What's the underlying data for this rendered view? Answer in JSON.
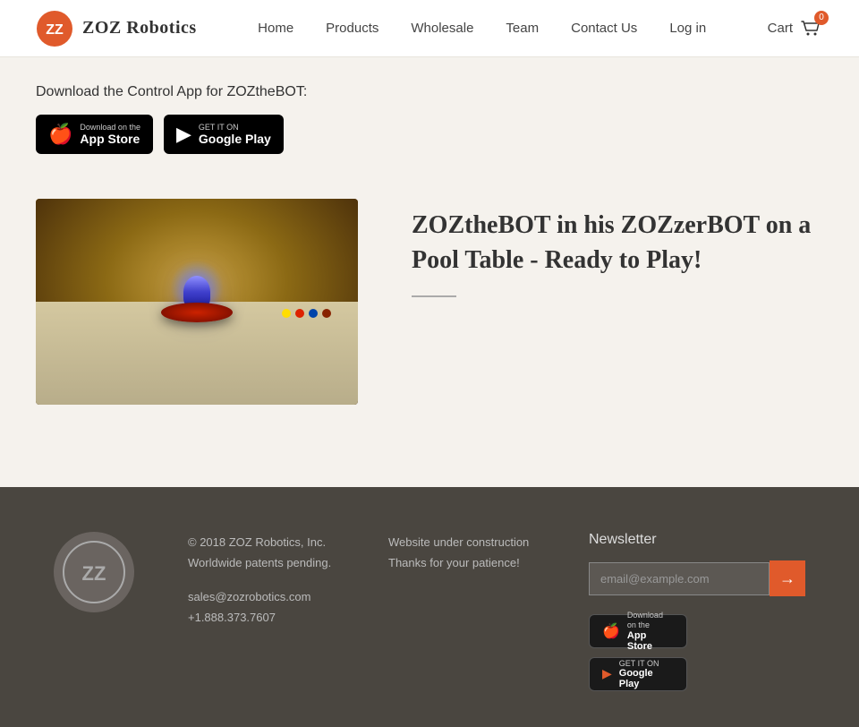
{
  "brand": {
    "name": "ZOZ Robotics",
    "logo_alt": "ZOZ logo"
  },
  "nav": {
    "home": "Home",
    "products": "Products",
    "wholesale": "Wholesale",
    "team": "Team",
    "contact": "Contact Us",
    "login": "Log in",
    "cart": "Cart",
    "cart_count": "0"
  },
  "main": {
    "download_heading": "Download the Control App for ZOZtheBOT:",
    "app_store_small": "Download on the",
    "app_store_large": "App Store",
    "google_play_small": "GET IT ON",
    "google_play_large": "Google Play",
    "product_title": "ZOZtheBOT in his ZOZzerBOT on a Pool Table - Ready to Play!",
    "product_image_alt": "ZOZtheBOT robot on pool table"
  },
  "footer": {
    "copyright": "© 2018 ZOZ Robotics, Inc.",
    "patents": "Worldwide patents pending.",
    "email": "sales@zozrobotics.com",
    "phone": "+1.888.373.7607",
    "website_status": "Website under construction",
    "patience": "Thanks for your patience!",
    "newsletter_title": "Newsletter",
    "newsletter_placeholder": "email@example.com",
    "app_store_small": "Download on the",
    "app_store_large": "App Store",
    "google_play_small": "GET IT ON",
    "google_play_large": "Google Play"
  }
}
